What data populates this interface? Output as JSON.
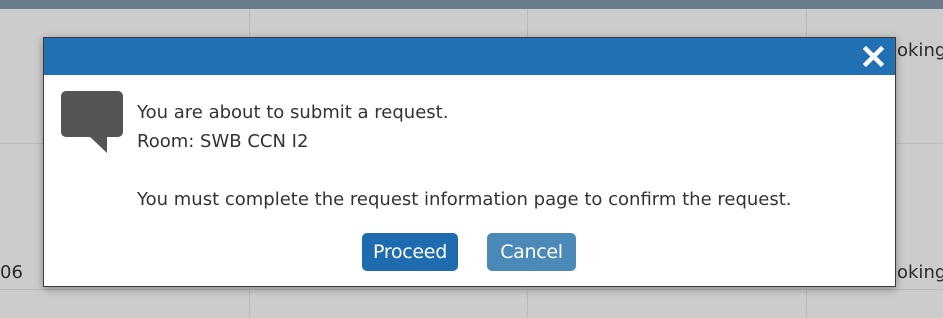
{
  "background": {
    "row_labels_right": [
      "oking",
      "oking"
    ],
    "row_label_left": "06"
  },
  "dialog": {
    "close_icon": "close-icon",
    "message_icon": "speech-bubble-icon",
    "line1": "You are about to submit a request.",
    "line2": "Room: SWB CCN I2",
    "line3": "You must complete the request information page to confirm the request.",
    "proceed_label": "Proceed",
    "cancel_label": "Cancel"
  },
  "colors": {
    "titlebar": "#2170b1",
    "proceed_button": "#1f6bb0",
    "cancel_button": "#4a89b8",
    "overlay": "#cccccc"
  }
}
